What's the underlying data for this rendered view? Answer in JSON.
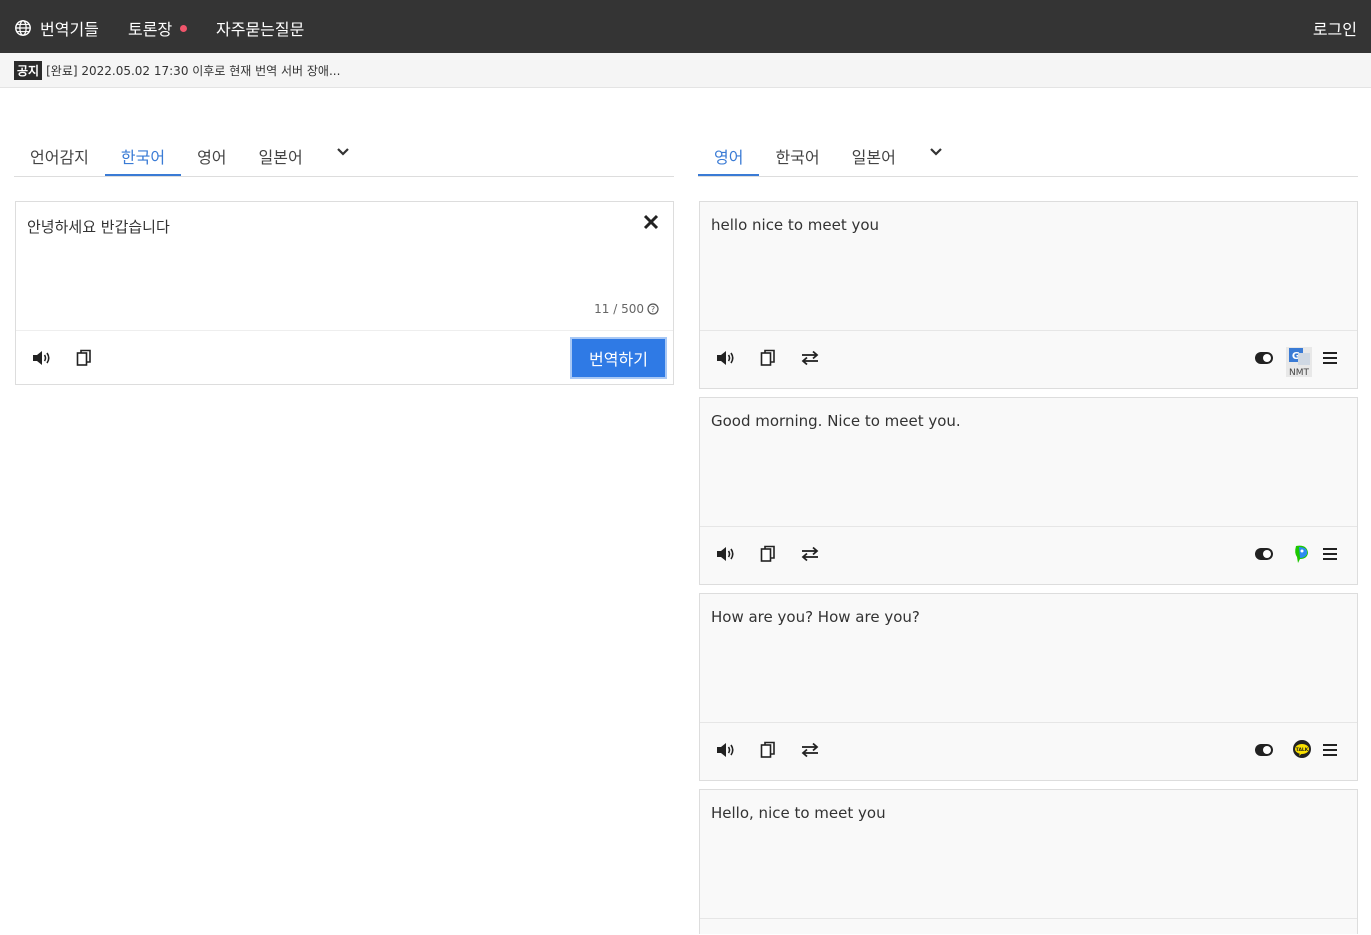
{
  "nav": {
    "brand": "번역기들",
    "forum": "토론장",
    "faq": "자주묻는질문",
    "login": "로그인"
  },
  "notice": {
    "tag": "공지",
    "text": "[완료] 2022.05.02 17:30 이후로 현재 번역 서버 장애..."
  },
  "source": {
    "tabs": [
      "언어감지",
      "한국어",
      "영어",
      "일본어"
    ],
    "active_tab": "한국어",
    "text": "안녕하세요 반갑습니다",
    "counter": "11 / 500",
    "translate_label": "번역하기"
  },
  "target": {
    "tabs": [
      "영어",
      "한국어",
      "일본어"
    ],
    "active_tab": "영어"
  },
  "results": [
    {
      "text": "hello nice to meet you",
      "engine": "google-nmt-icon",
      "engine_label": "NMT"
    },
    {
      "text": "Good morning. Nice to meet you.",
      "engine": "papago-icon"
    },
    {
      "text": "How are you? How are you?",
      "engine": "kakao-talk-icon",
      "engine_label": "TALK"
    },
    {
      "text": "Hello, nice to meet you"
    }
  ],
  "colors": {
    "accent": "#2f7ae5",
    "topbar": "#343434",
    "dot": "#f0556b"
  }
}
